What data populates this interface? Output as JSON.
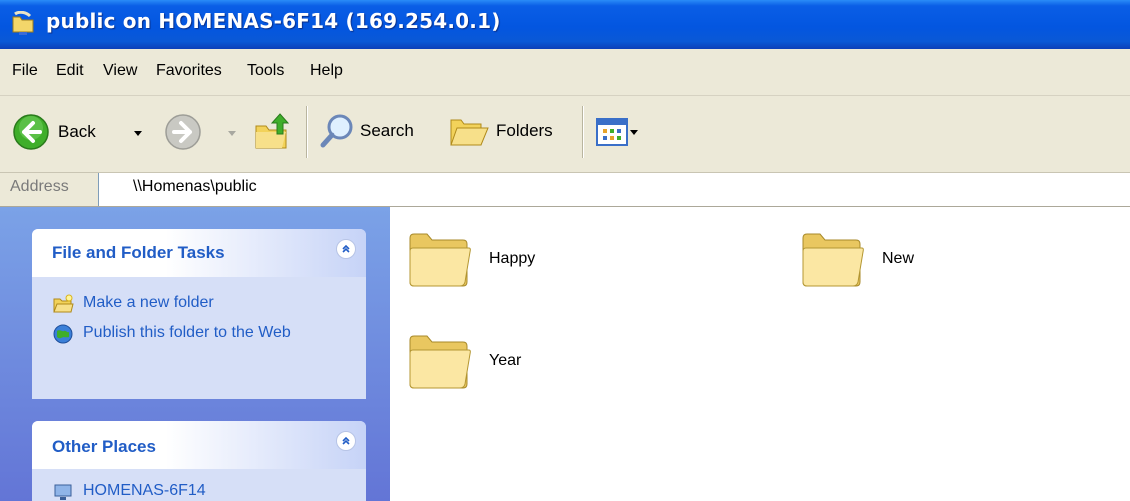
{
  "window": {
    "title": "public on HOMENAS-6F14 (169.254.0.1)",
    "icon": "network-folder-icon"
  },
  "menu": [
    "File",
    "Edit",
    "View",
    "Favorites",
    "Tools",
    "Help"
  ],
  "toolbar": {
    "back_label": "Back",
    "search_label": "Search",
    "folders_label": "Folders"
  },
  "address": {
    "label": "Address",
    "value": "\\\\Homenas\\public"
  },
  "task_pane": {
    "file_folder_tasks": {
      "title": "File and Folder Tasks",
      "items": [
        "Make a new folder",
        "Publish this folder to the Web"
      ]
    },
    "other_places": {
      "title": "Other Places",
      "items": [
        "HOMENAS-6F14"
      ]
    }
  },
  "folders": [
    "Happy",
    "New",
    "Year"
  ],
  "colors": {
    "title_bar": "#0356e0",
    "task_pane": "#6d8ede",
    "task_link": "#215dc6",
    "chrome": "#ece9d8"
  }
}
